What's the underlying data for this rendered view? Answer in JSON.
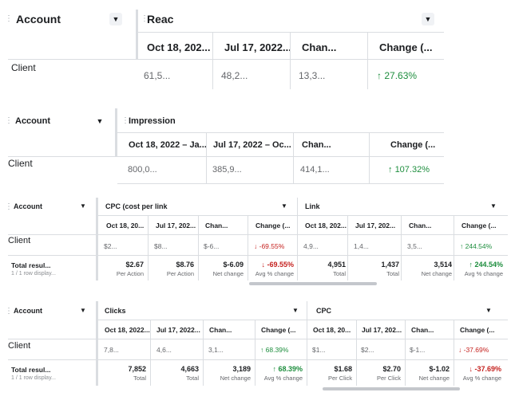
{
  "p1": {
    "account": "Account",
    "metric": "Reac",
    "cols": [
      "Oct 18, 202...",
      "Jul 17, 2022...",
      "Chan...",
      "Change (..."
    ],
    "row_label": "Client",
    "cells": [
      "61,5...",
      "48,2...",
      "13,3...",
      "27.63%"
    ]
  },
  "p2": {
    "account": "Account",
    "metric": "Impression",
    "cols": [
      "Oct 18, 2022 – Ja...",
      "Jul 17, 2022 – Oc...",
      "Chan...",
      "Change (..."
    ],
    "row_label": "Client",
    "cells": [
      "800,0...",
      "385,9...",
      "414,1...",
      "107.32%"
    ]
  },
  "p3": {
    "account": "Account",
    "metric1": "CPC (cost per link",
    "metric2": "Link",
    "cols": [
      "Oct 18, 20...",
      "Jul 17, 202...",
      "Chan...",
      "Change (...",
      "Oct 18, 202...",
      "Jul 17, 202...",
      "Chan...",
      "Change (..."
    ],
    "row_label": "Client",
    "cells": [
      "$2...",
      "$8...",
      "$-6...",
      "-69.55%",
      "4,9...",
      "1,4...",
      "3,5...",
      "244.54%"
    ],
    "total_label": "Total resul...",
    "total_sub": "1 / 1 row display...",
    "totals": [
      "$2.67",
      "$8.76",
      "$-6.09",
      "-69.55%",
      "4,951",
      "1,437",
      "3,514",
      "244.54%"
    ],
    "total_subs": [
      "Per Action",
      "Per Action",
      "Net change",
      "Avg % change",
      "Total",
      "Total",
      "Net change",
      "Avg % change"
    ]
  },
  "p4": {
    "account": "Account",
    "metric1": "Clicks",
    "metric2": "CPC",
    "cols": [
      "Oct 18, 2022...",
      "Jul 17, 2022...",
      "Chan...",
      "Change (...",
      "Oct 18, 20...",
      "Jul 17, 202...",
      "Chan...",
      "Change (..."
    ],
    "row_label": "Client",
    "cells": [
      "7,8...",
      "4,6...",
      "3,1...",
      "68.39%",
      "$1...",
      "$2...",
      "$-1...",
      "-37.69%"
    ],
    "total_label": "Total resul...",
    "total_sub": "1 / 1 row display...",
    "totals": [
      "7,852",
      "4,663",
      "3,189",
      "68.39%",
      "$1.68",
      "$2.70",
      "$-1.02",
      "-37.69%"
    ],
    "total_subs": [
      "Total",
      "Total",
      "Net change",
      "Avg % change",
      "Per Click",
      "Per Click",
      "Net change",
      "Avg % change"
    ]
  },
  "icons": {
    "caret": "caret-down-icon",
    "grip": "drag-handle-icon",
    "up": "arrow-up-icon",
    "down": "arrow-down-icon"
  },
  "colors": {
    "positive": "#1e8e3e",
    "negative": "#c5221f",
    "border": "#dadde1"
  }
}
